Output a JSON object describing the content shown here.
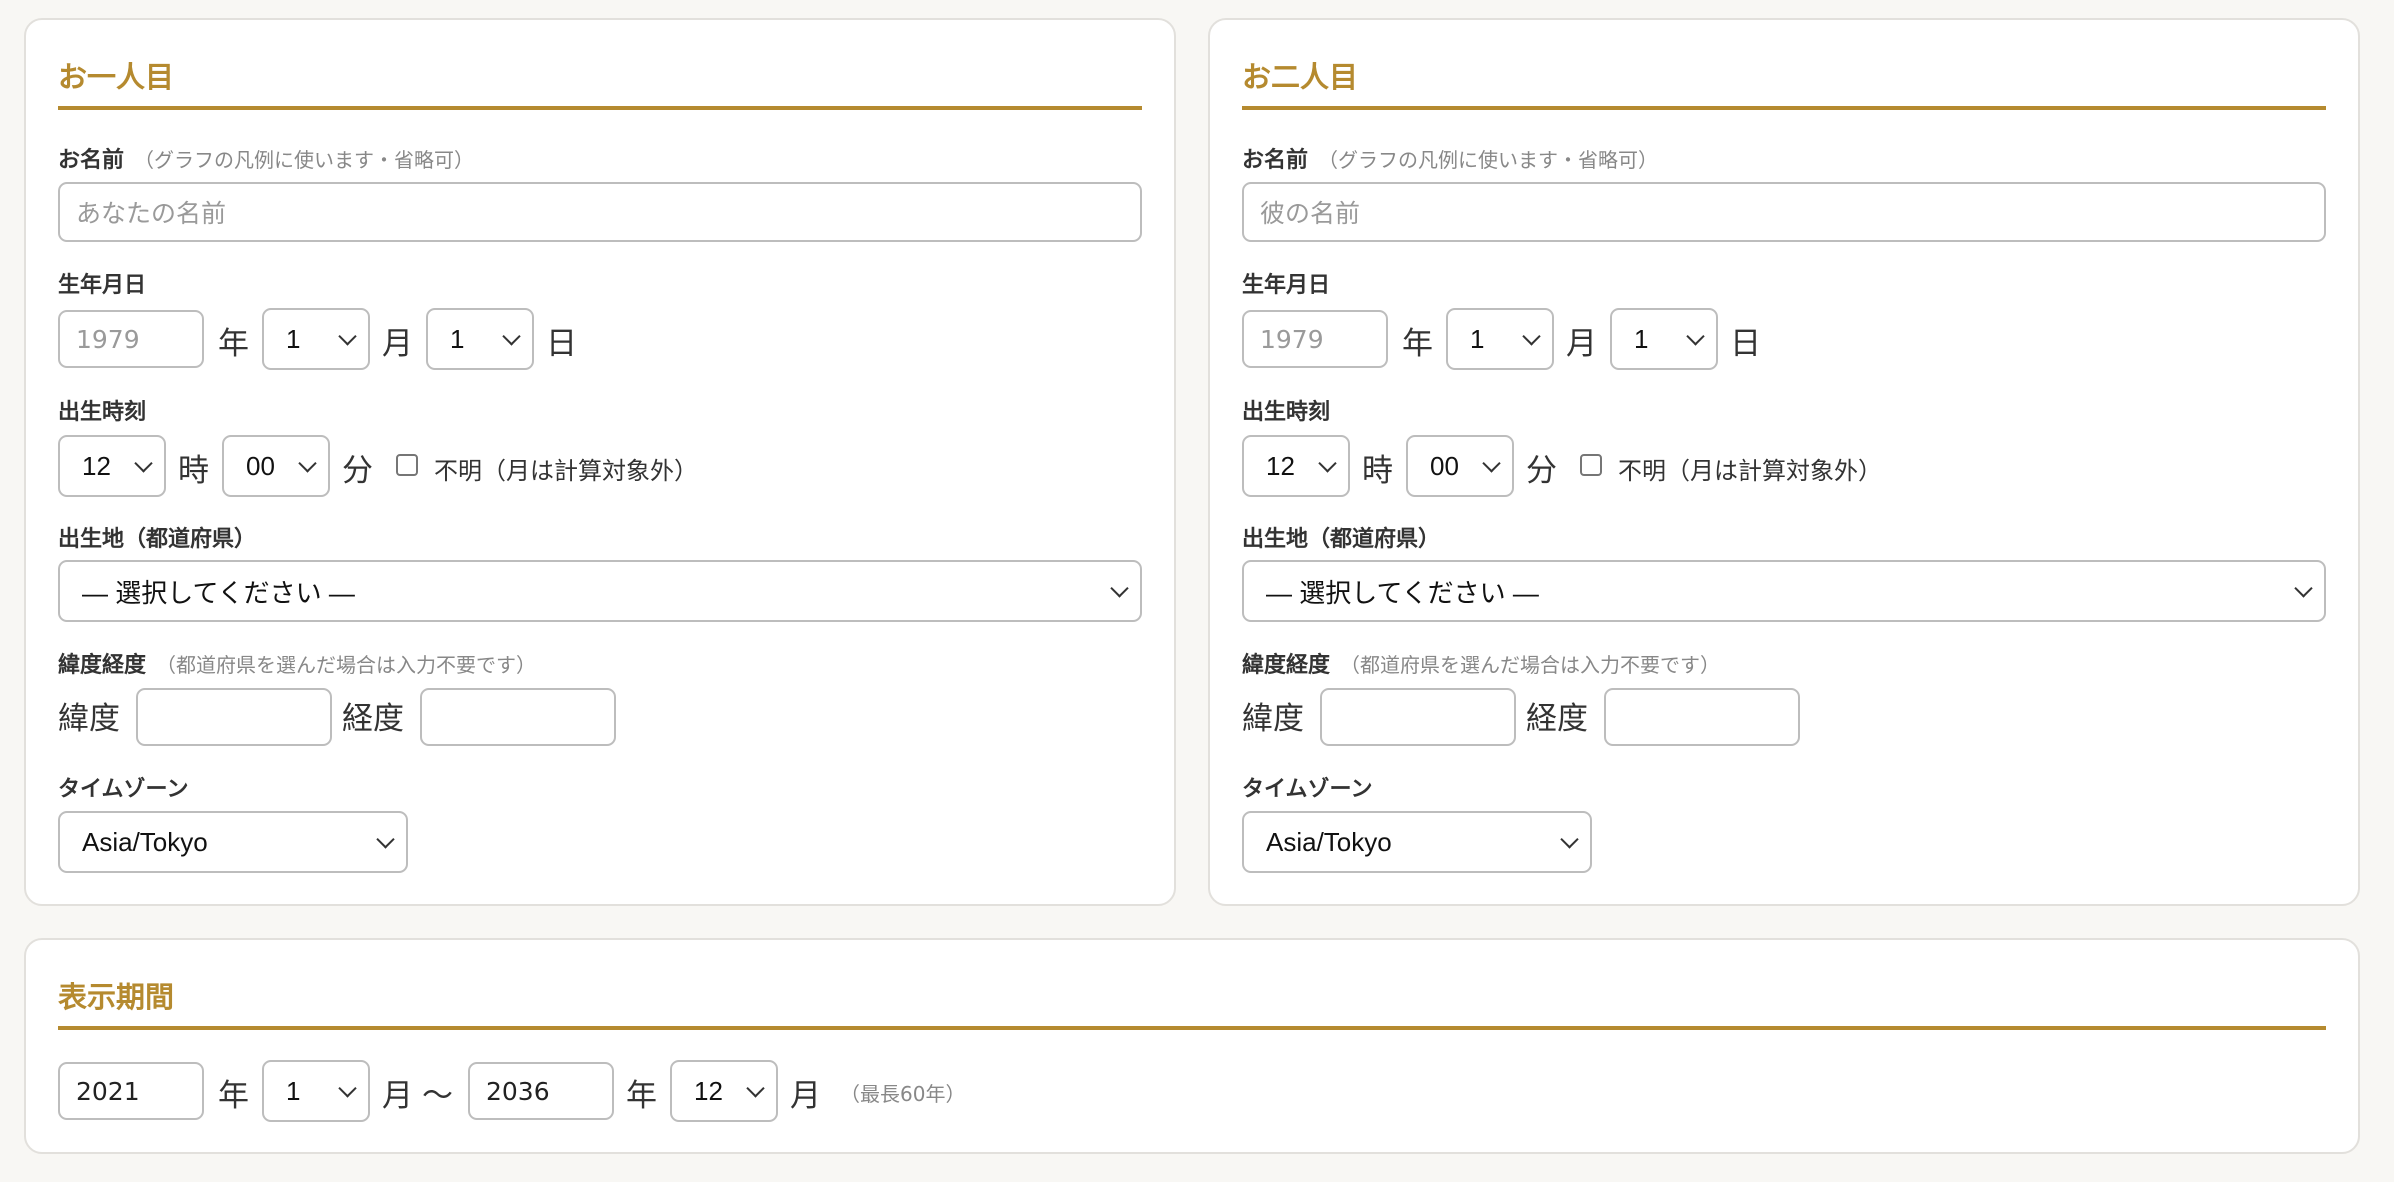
{
  "person1": {
    "title": "お一人目",
    "name_label": "お名前",
    "name_note": "（グラフの凡例に使います・省略可）",
    "name_placeholder": "あなたの名前",
    "birthdate_label": "生年月日",
    "year_placeholder": "1979",
    "year_unit": "年",
    "month_value": "1",
    "month_unit": "月",
    "day_value": "1",
    "day_unit": "日",
    "birthtime_label": "出生時刻",
    "hour_value": "12",
    "hour_unit": "時",
    "minute_value": "00",
    "minute_unit": "分",
    "unknown_label": "不明（月は計算対象外）",
    "place_label": "出生地（都道府県）",
    "place_value": "— 選択してください —",
    "latlon_label": "緯度経度",
    "latlon_note": "（都道府県を選んだ場合は入力不要です）",
    "lat_label": "緯度",
    "lon_label": "経度",
    "lat_value": "",
    "lon_value": "",
    "timezone_label": "タイムゾーン",
    "timezone_value": "Asia/Tokyo"
  },
  "person2": {
    "title": "お二人目",
    "name_label": "お名前",
    "name_note": "（グラフの凡例に使います・省略可）",
    "name_placeholder": "彼の名前",
    "birthdate_label": "生年月日",
    "year_placeholder": "1979",
    "year_unit": "年",
    "month_value": "1",
    "month_unit": "月",
    "day_value": "1",
    "day_unit": "日",
    "birthtime_label": "出生時刻",
    "hour_value": "12",
    "hour_unit": "時",
    "minute_value": "00",
    "minute_unit": "分",
    "unknown_label": "不明（月は計算対象外）",
    "place_label": "出生地（都道府県）",
    "place_value": "— 選択してください —",
    "latlon_label": "緯度経度",
    "latlon_note": "（都道府県を選んだ場合は入力不要です）",
    "lat_label": "緯度",
    "lon_label": "経度",
    "lat_value": "",
    "lon_value": "",
    "timezone_label": "タイムゾーン",
    "timezone_value": "Asia/Tokyo"
  },
  "period": {
    "title": "表示期間",
    "start_year": "2021",
    "year_unit": "年",
    "start_month": "1",
    "month_unit": "月",
    "tilde": "〜",
    "end_year": "2036",
    "end_month": "12",
    "max_note": "（最長60年）"
  },
  "colors": {
    "accent": "#b58a2f",
    "background": "#f8f7f4",
    "panel": "#ffffff",
    "border": "#e2e0dc"
  }
}
